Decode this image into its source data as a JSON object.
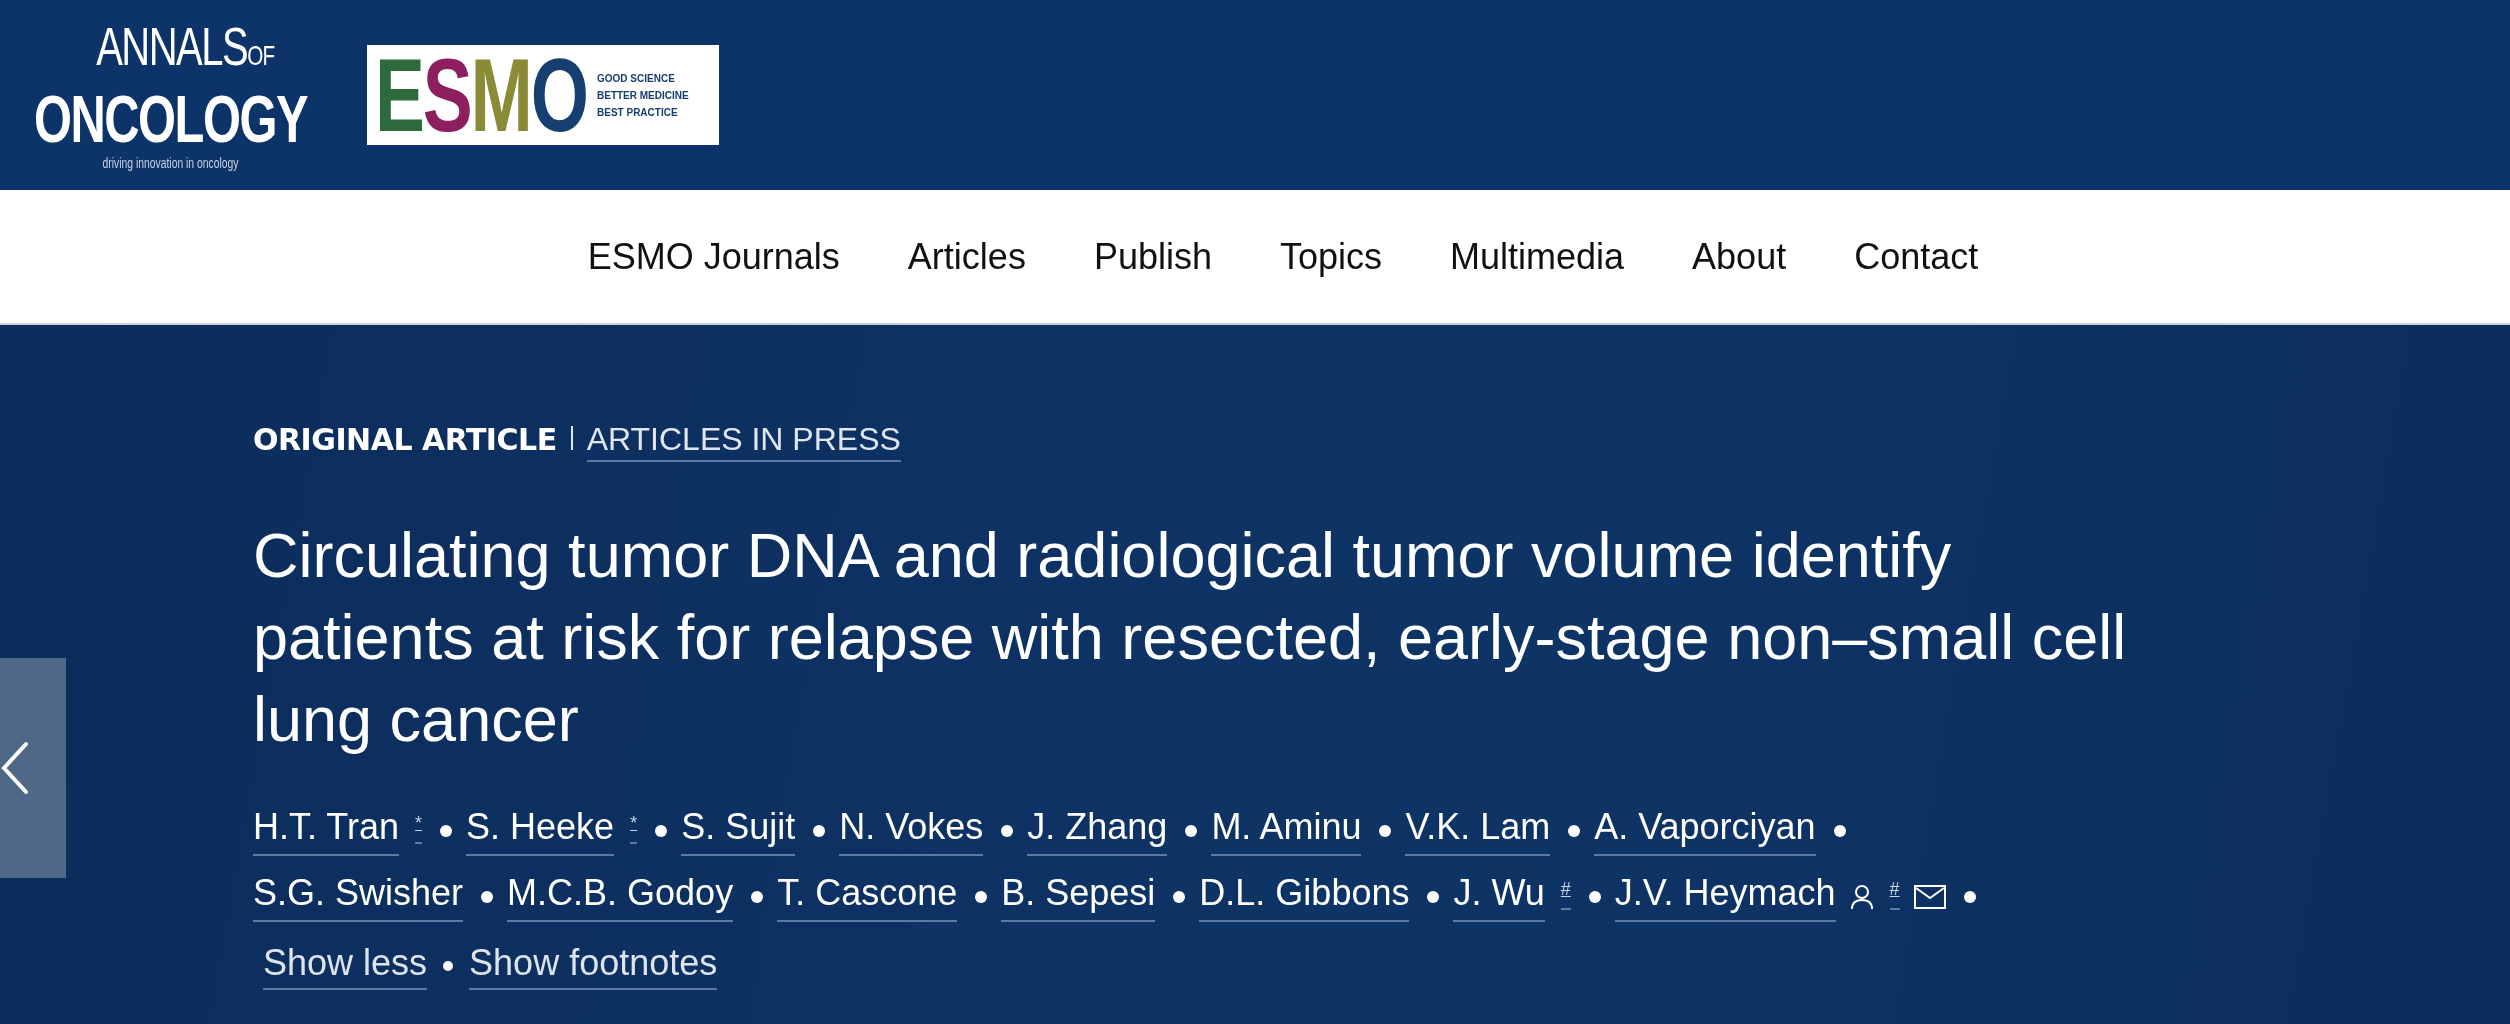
{
  "journal_logo": {
    "line_1": "ANNALS",
    "line_1_suffix": "OF",
    "line_2": "ONCOLOGY",
    "tagline": "driving innovation in oncology"
  },
  "society_logo": {
    "letters": [
      {
        "char": "E",
        "color": "#2d6a3c"
      },
      {
        "char": "S",
        "color": "#8e1f5f"
      },
      {
        "char": "M",
        "color": "#8b8a36"
      },
      {
        "char": "O",
        "color": "#153f70"
      }
    ],
    "tagline": [
      "GOOD SCIENCE",
      "BETTER MEDICINE",
      "BEST PRACTICE"
    ]
  },
  "nav": {
    "items": [
      "ESMO Journals",
      "Articles",
      "Publish",
      "Topics",
      "Multimedia",
      "About",
      "Contact"
    ]
  },
  "article": {
    "type": "ORIGINAL ARTICLE",
    "section": "ARTICLES IN PRESS",
    "title": "Circulating tumor DNA and radiological tumor volume identify patients at risk for relapse with resected, early-stage non–small cell lung cancer",
    "authors": [
      {
        "name": "H.T. Tran",
        "marks": [
          "*"
        ],
        "profile": false,
        "email": false
      },
      {
        "name": "S. Heeke",
        "marks": [
          "*"
        ],
        "profile": false,
        "email": false
      },
      {
        "name": "S. Sujit",
        "profile": false,
        "email": false
      },
      {
        "name": "N. Vokes",
        "profile": false,
        "email": false
      },
      {
        "name": "J. Zhang",
        "profile": false,
        "email": false
      },
      {
        "name": "M. Aminu",
        "profile": false,
        "email": false
      },
      {
        "name": "V.K. Lam",
        "profile": false,
        "email": false
      },
      {
        "name": "A. Vaporciyan",
        "profile": false,
        "email": false
      },
      {
        "name": "S.G. Swisher",
        "profile": false,
        "email": false
      },
      {
        "name": "M.C.B. Godoy",
        "profile": false,
        "email": false
      },
      {
        "name": "T. Cascone",
        "profile": false,
        "email": false
      },
      {
        "name": "B. Sepesi",
        "profile": false,
        "email": false
      },
      {
        "name": "D.L. Gibbons",
        "profile": false,
        "email": false
      },
      {
        "name": "J. Wu",
        "marks": [
          "#"
        ],
        "profile": false,
        "email": false
      },
      {
        "name": "J.V. Heymach",
        "marks": [
          "#"
        ],
        "profile": true,
        "email": true
      }
    ],
    "links": [
      "Show less",
      "Show footnotes"
    ]
  },
  "carousel": {
    "previous_button": true
  }
}
